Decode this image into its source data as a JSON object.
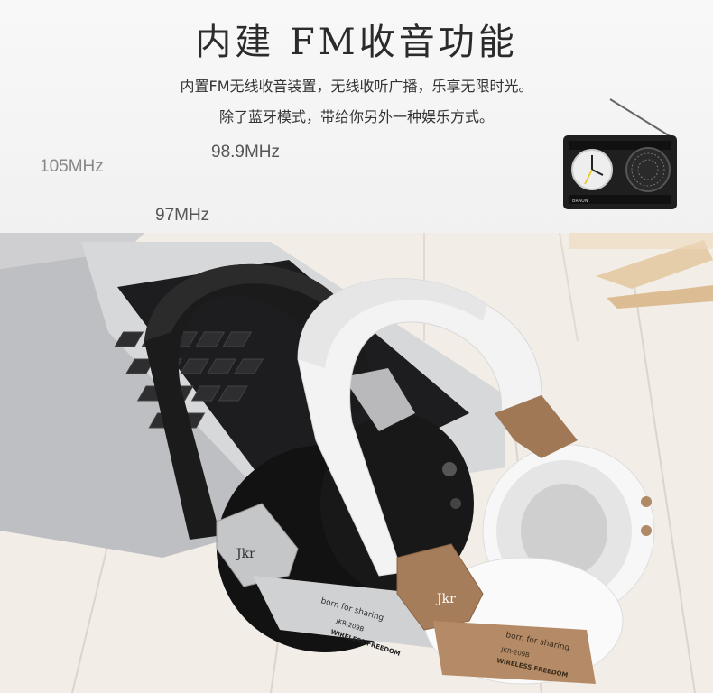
{
  "header": {
    "title": "内建 FM收音功能",
    "line1": "内置FM无线收音装置，无线收听广播，乐享无限时光。",
    "line2": "除了蓝牙模式，带给你另外一种娱乐方式。"
  },
  "frequencies": [
    "105MHz",
    "98.9MHz",
    "97MHz"
  ],
  "radio": {
    "brand": "BRAUN"
  },
  "product": {
    "logo": "Jkr",
    "tagline": "born for sharing",
    "model": "JKR-209B",
    "subtitle": "WIRELESS FREEDOM"
  }
}
